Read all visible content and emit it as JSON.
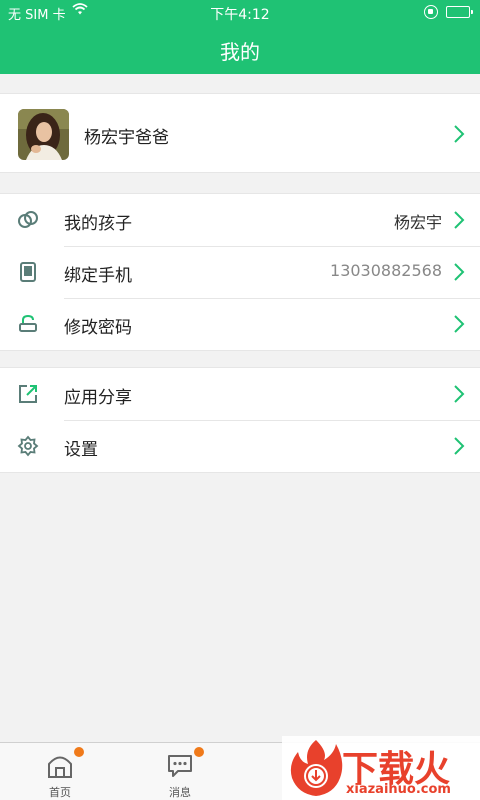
{
  "status_bar": {
    "carrier": "无 SIM 卡",
    "time": "下午4:12",
    "battery_level": 1.0
  },
  "header": {
    "title": "我的"
  },
  "profile": {
    "name": "杨宏宇爸爸",
    "avatar_icon": "user-photo"
  },
  "menu_group_1": [
    {
      "label": "我的孩子",
      "value": "杨宏宇",
      "icon": "rings-icon"
    },
    {
      "label": "绑定手机",
      "value": "13030882568",
      "icon": "phone-icon"
    },
    {
      "label": "修改密码",
      "value": "",
      "icon": "lock-icon"
    }
  ],
  "menu_group_2": [
    {
      "label": "应用分享",
      "icon": "share-icon"
    },
    {
      "label": "设置",
      "icon": "gear-icon"
    }
  ],
  "tabbar": [
    {
      "label": "首页",
      "icon": "home-icon",
      "badge": true
    },
    {
      "label": "消息",
      "icon": "message-icon",
      "badge": true
    }
  ],
  "watermark": {
    "brand": "下载火",
    "url": "xiazaihuo.com"
  },
  "colors": {
    "accent": "#1fc274",
    "badge": "#f07a1a",
    "icon": "#5a7d78",
    "watermark": "#e8412c"
  }
}
